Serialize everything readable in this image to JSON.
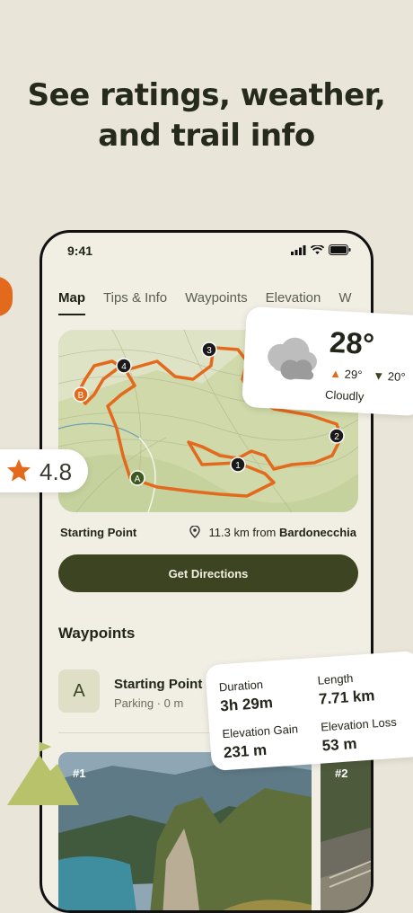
{
  "headline": {
    "line1": "See ratings, weather,",
    "line2": "and trail info"
  },
  "status_bar": {
    "time": "9:41"
  },
  "tabs": [
    {
      "label": "Map",
      "active": true
    },
    {
      "label": "Tips & Info"
    },
    {
      "label": "Waypoints"
    },
    {
      "label": "Elevation"
    },
    {
      "label": "W"
    }
  ],
  "map": {
    "markers": [
      "A",
      "B",
      "1",
      "2",
      "3",
      "4"
    ],
    "colors": {
      "trail": "#e36a1d",
      "land": "#cfd9a9",
      "marker": "#1a1a1a"
    }
  },
  "start": {
    "label": "Starting Point",
    "distance": "11.3 km from",
    "town": "Bardonecchia"
  },
  "directions_button": "Get Directions",
  "waypoints": {
    "title": "Waypoints",
    "items": [
      {
        "badge": "A",
        "name": "Starting Point",
        "detail": "Parking · 0 m"
      }
    ]
  },
  "photos": [
    {
      "label": "#1"
    },
    {
      "label": "#2"
    }
  ],
  "weather": {
    "temperature": "28°",
    "high": "29°",
    "low": "20°",
    "condition": "Cloudly"
  },
  "rating": {
    "value": "4.8"
  },
  "stats": {
    "duration_label": "Duration",
    "duration": "3h 29m",
    "length_label": "Length",
    "length": "7.71 km",
    "gain_label": "Elevation Gain",
    "gain": "231 m",
    "loss_label": "Elevation Loss",
    "loss": "53 m"
  },
  "brand_colors": {
    "accent": "#e36a1d",
    "button": "#3d4421",
    "background": "#e9e6d9"
  }
}
